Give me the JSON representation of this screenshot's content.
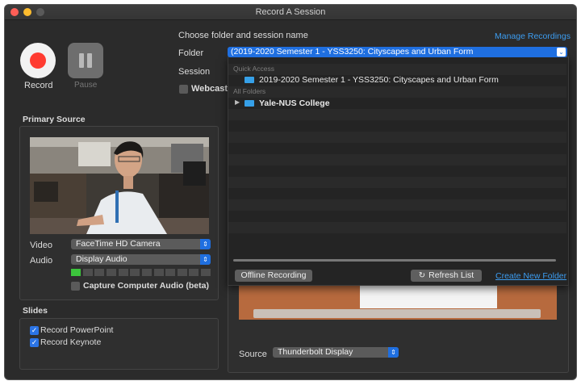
{
  "window": {
    "title": "Record A Session"
  },
  "controls": {
    "record_label": "Record",
    "pause_label": "Pause"
  },
  "header": {
    "choose_label": "Choose folder and session name",
    "manage_link": "Manage Recordings"
  },
  "form": {
    "folder_label": "Folder",
    "folder_value": "(2019-2020 Semester 1 - YSS3250: Cityscapes and Urban Form",
    "session_label": "Session",
    "webcast_label": "Webcast"
  },
  "dropdown": {
    "quick_access_header": "Quick Access",
    "quick_item": "2019-2020 Semester 1 - YSS3250: Cityscapes and Urban Form",
    "all_folders_header": "All Folders",
    "tree_item": "Yale-NUS College",
    "offline_button": "Offline Recording",
    "refresh_button": "Refresh List",
    "create_link": "Create New Folder"
  },
  "primary": {
    "title": "Primary Source",
    "video_label": "Video",
    "video_value": "FaceTime HD Camera",
    "audio_label": "Audio",
    "audio_value": "Display Audio",
    "capture_label": "Capture Computer Audio (beta)",
    "audio_level": 0.06
  },
  "slides": {
    "title": "Slides",
    "powerpoint_label": "Record PowerPoint",
    "keynote_label": "Record Keynote"
  },
  "secondary": {
    "source_label": "Source",
    "source_value": "Thunderbolt Display"
  },
  "colors": {
    "accent": "#1f6fe0",
    "record_red": "#ff3b30",
    "link": "#3c9cf0"
  }
}
